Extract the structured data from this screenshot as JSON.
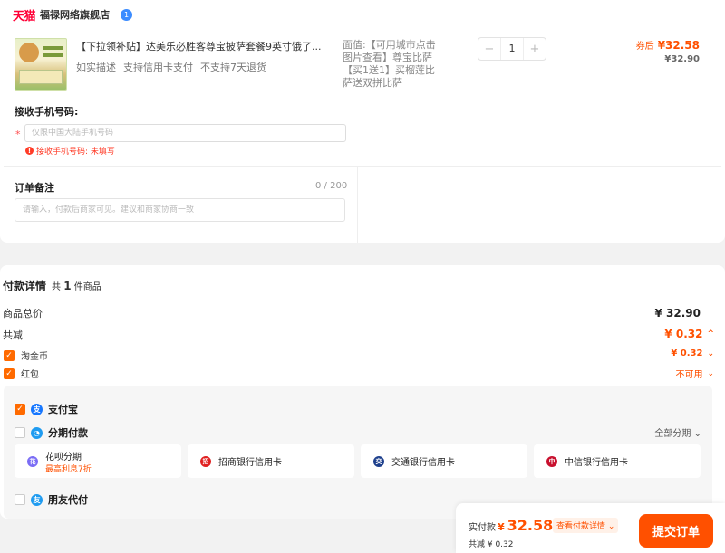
{
  "shop": {
    "logo": "天猫",
    "name": "福禄网络旗舰店",
    "badge": "1"
  },
  "product": {
    "title": "【下拉领补贴】达美乐必胜客尊宝披萨套餐9英寸饿了...",
    "tags": [
      "如实描述",
      "支持信用卡支付",
      "不支持7天退货"
    ],
    "spec": "面值:【可用城市点击图片查看】尊宝比萨【买1送1】买榴莲比萨送双拼比萨",
    "quantity": "1",
    "qty_minus": "−",
    "qty_plus": "+",
    "price_after_label": "券后",
    "price_after": "¥32.58",
    "price_orig": "¥32.90"
  },
  "phone": {
    "label": "接收手机号码:",
    "star": "*",
    "placeholder": "仅限中国大陆手机号码",
    "error_icon": "!",
    "error": "接收手机号码: 未填写"
  },
  "note": {
    "label": "订单备注",
    "count": "0 / 200",
    "placeholder": "请输入，付款后商家可见。建议和商家协商一致"
  },
  "payment": {
    "title": "付款详情",
    "count_prefix": "共",
    "count": "1",
    "count_suffix": "件商品",
    "subtotal_label": "商品总价",
    "subtotal": "¥ 32.90",
    "discount_label": "共减",
    "discount": "¥ 0.32",
    "coin_label": "淘金币",
    "coin_value": "¥ 0.32",
    "redpack_label": "红包",
    "redpack_value": "不可用"
  },
  "methods": {
    "alipay": "支付宝",
    "installment": "分期付款",
    "all_installment": "全部分期",
    "huabei_title": "花呗分期",
    "huabei_sub": "最高利息7折",
    "cmb": "招商银行信用卡",
    "bocom": "交通银行信用卡",
    "citic": "中信银行信用卡",
    "friend": "朋友代付"
  },
  "submit": {
    "total_label": "实付款",
    "yen": "¥",
    "total": "32.58",
    "detail_link": "查看付款详情",
    "saved": "共减 ¥ 0.32",
    "button": "提交订单"
  },
  "colors": {
    "accent": "#ff5000",
    "tmall": "#ff0036",
    "alipay": "#1677ff"
  }
}
